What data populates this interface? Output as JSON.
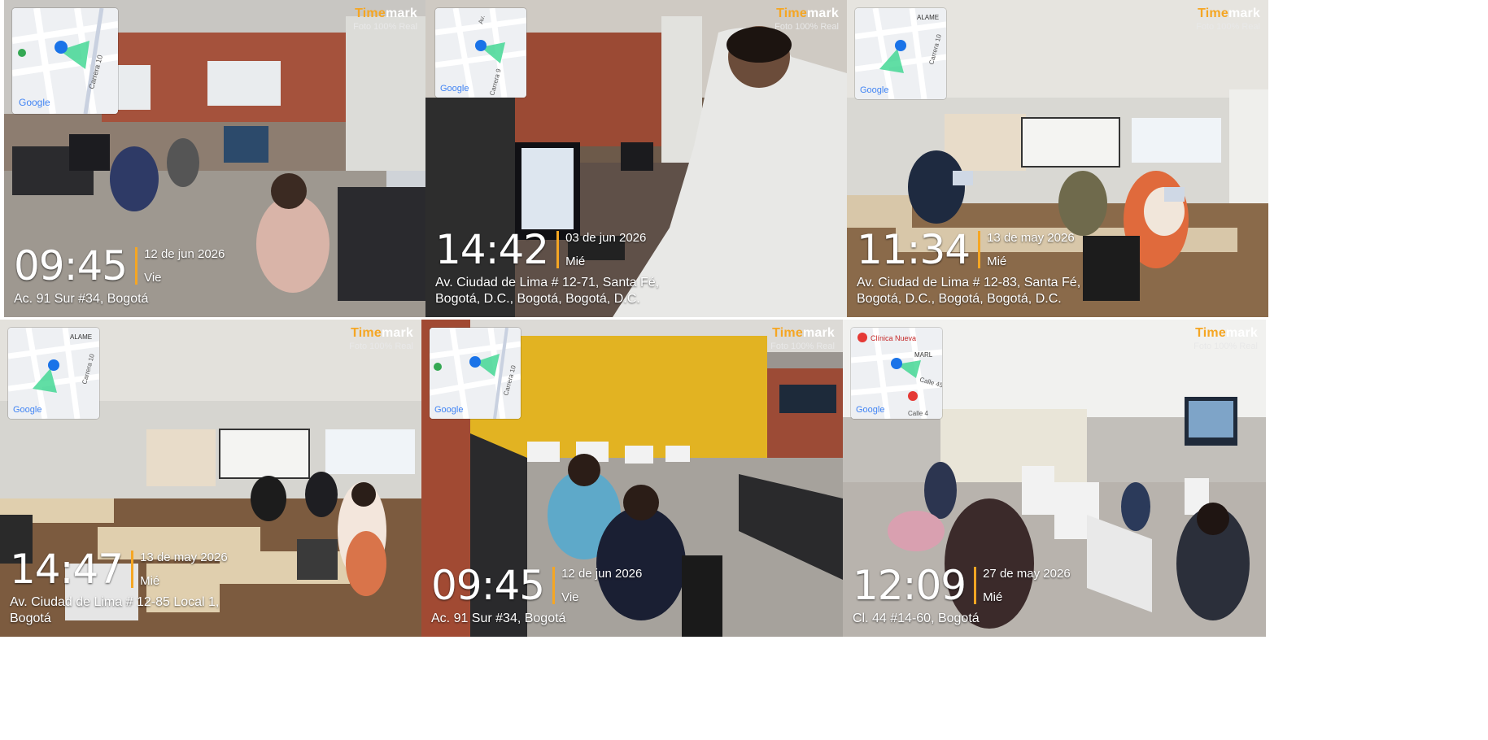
{
  "tiles": [
    {
      "brand_a": "Time",
      "brand_b": "mark",
      "tagline": "Foto 100% Real",
      "time": "09:45",
      "date": "12 de jun 2026",
      "day": "Vie",
      "address": [
        "Ac. 91 Sur #34, Bogotá"
      ],
      "map_labels": [
        "Google",
        "Carrera 10"
      ],
      "scene": "computer-lab-brick"
    },
    {
      "brand_a": "Time",
      "brand_b": "mark",
      "tagline": "Foto 100% Real",
      "time": "14:42",
      "date": "03 de jun 2026",
      "day": "Mié",
      "address": [
        "Av. Ciudad de Lima # 12-71, Santa Fé,",
        "Bogotá, D.C., Bogotá, Bogotá, D.C."
      ],
      "map_labels": [
        "Google",
        "Av.",
        "Carrera 9"
      ],
      "scene": "instructor-lab"
    },
    {
      "brand_a": "Time",
      "brand_b": "mark",
      "tagline": "Foto 100% Real",
      "time": "11:34",
      "date": "13 de may 2026",
      "day": "Mié",
      "address": [
        "Av. Ciudad de Lima # 12-83, Santa Fé,",
        "Bogotá, D.C., Bogotá, Bogotá, D.C."
      ],
      "map_labels": [
        "Google",
        "ALAME",
        "Carrera 10"
      ],
      "scene": "classroom-laptops"
    },
    {
      "brand_a": "Time",
      "brand_b": "mark",
      "tagline": "Foto 100% Real",
      "time": "14:47",
      "date": "13 de may 2026",
      "day": "Mié",
      "address": [
        "Av. Ciudad de Lima # 12-85 Local 1,",
        "Bogotá"
      ],
      "map_labels": [
        "Google",
        "ALAME",
        "Carrera 10"
      ],
      "scene": "classroom-desks"
    },
    {
      "brand_a": "Time",
      "brand_b": "mark",
      "tagline": "Foto 100% Real",
      "time": "09:45",
      "date": "12 de jun 2026",
      "day": "Vie",
      "address": [
        "Ac. 91 Sur #34, Bogotá"
      ],
      "map_labels": [
        "Google",
        "Carrera 10"
      ],
      "scene": "yellow-lab"
    },
    {
      "brand_a": "Time",
      "brand_b": "mark",
      "tagline": "Foto 100% Real",
      "time": "12:09",
      "date": "27 de may 2026",
      "day": "Mié",
      "address": [
        "Cl. 44 #14-60, Bogotá"
      ],
      "map_labels": [
        "Google",
        "Clínica Nueva",
        "MARL",
        "Calle 45",
        "Calle 4"
      ],
      "scene": "bright-lab"
    }
  ]
}
